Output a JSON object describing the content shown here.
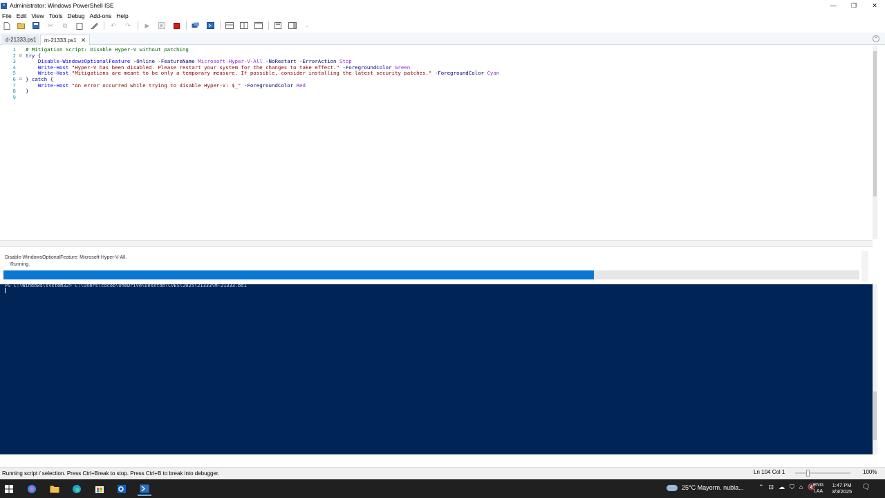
{
  "window": {
    "title": "Administrator: Windows PowerShell ISE",
    "controls": {
      "minimize": "—",
      "restore": "❐",
      "close": "✕"
    }
  },
  "menubar": [
    "File",
    "Edit",
    "View",
    "Tools",
    "Debug",
    "Add-ons",
    "Help"
  ],
  "toolbar": {
    "icons": [
      "new-file-icon",
      "open-file-icon",
      "save-icon",
      "cut-icon",
      "copy-icon",
      "paste-icon",
      "clear-icon",
      "undo-icon",
      "redo-icon",
      "run-script-icon",
      "run-selection-icon",
      "stop-icon",
      "remote-powershell-icon",
      "powershell-console-icon",
      "show-script-top-icon",
      "show-script-right-icon",
      "show-script-maximized-icon",
      "show-command-window-icon",
      "show-command-addon-icon"
    ]
  },
  "tabs": [
    {
      "label": "d-21333.ps1",
      "active": false
    },
    {
      "label": "m-21333.ps1",
      "active": true
    }
  ],
  "editor": {
    "lines": [
      [
        {
          "t": "# Mitigation Script: Disable Hyper-V without patching",
          "c": "c-comment"
        }
      ],
      [
        {
          "t": "try {",
          "c": "c-kw"
        }
      ],
      [
        {
          "t": "    ",
          "c": "c-plain"
        },
        {
          "t": "Disable-WindowsOptionalFeature",
          "c": "c-cmd"
        },
        {
          "t": " -Online -FeatureName ",
          "c": "c-param"
        },
        {
          "t": "Microsoft-Hyper-V-All",
          "c": "c-arg"
        },
        {
          "t": " -NoRestart -ErrorAction ",
          "c": "c-param"
        },
        {
          "t": "Stop",
          "c": "c-arg"
        }
      ],
      [
        {
          "t": "    ",
          "c": "c-plain"
        },
        {
          "t": "Write-Host",
          "c": "c-cmd"
        },
        {
          "t": " \"Hyper-V has been disabled. Please restart your system for the changes to take effect.\"",
          "c": "c-str"
        },
        {
          "t": " -ForegroundColor ",
          "c": "c-param"
        },
        {
          "t": "Green",
          "c": "c-arg"
        }
      ],
      [
        {
          "t": "    ",
          "c": "c-plain"
        },
        {
          "t": "Write-Host",
          "c": "c-cmd"
        },
        {
          "t": " \"Mitigations are meant to be only a temporary measure. If possible, consider installing the latest security patches.\"",
          "c": "c-str"
        },
        {
          "t": " -ForegroundColor ",
          "c": "c-param"
        },
        {
          "t": "Cyan",
          "c": "c-arg"
        }
      ],
      [
        {
          "t": "} catch {",
          "c": "c-kw"
        }
      ],
      [
        {
          "t": "    ",
          "c": "c-plain"
        },
        {
          "t": "Write-Host",
          "c": "c-cmd"
        },
        {
          "t": " \"An error occurred while trying to disable Hyper-V: $_\"",
          "c": "c-str"
        },
        {
          "t": " -ForegroundColor ",
          "c": "c-param"
        },
        {
          "t": "Red",
          "c": "c-arg"
        }
      ],
      [
        {
          "t": "}",
          "c": "c-kw"
        }
      ],
      [
        {
          "t": "",
          "c": "c-plain"
        }
      ]
    ],
    "line_numbers": [
      "1",
      "2",
      "3",
      "4",
      "5",
      "6",
      "7",
      "8",
      "9"
    ]
  },
  "progress": {
    "activity": "Disable-WindowsOptionalFeature: Microsoft-Hyper-V-All.",
    "status": "Running.",
    "fraction": 0.69,
    "color": "#0a78d1"
  },
  "console": {
    "prompt_line": "PS C:\\Windows\\system32> C:\\Users\\cocop\\OneDrive\\Desktop\\CVES\\2025\\21333\\m-21333.ps1"
  },
  "statusbar": {
    "message": "Running script / selection.  Press Ctrl+Break to stop.  Press Ctrl+B to break into debugger.",
    "position": "Ln 104  Col 1",
    "zoom": "100%"
  },
  "taskbar": {
    "weather": "25°C  Mayorm. nubla...",
    "lang": [
      "ENG",
      "LAA"
    ],
    "time": "1:47 PM",
    "date": "3/3/2025",
    "apps": [
      "start-icon",
      "copilot-icon",
      "file-explorer-icon",
      "edge-icon",
      "store-icon",
      "outlook-icon",
      "powershell-ise-icon"
    ]
  },
  "colors": {
    "console_bg": "#012456",
    "accent": "#0a78d1",
    "stop": "#d11c1c"
  }
}
